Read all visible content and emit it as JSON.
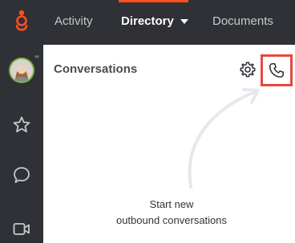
{
  "nav": {
    "tabs": [
      {
        "label": "Activity"
      },
      {
        "label": "Directory"
      },
      {
        "label": "Documents"
      }
    ],
    "active_tab": "Directory"
  },
  "rail": {
    "items": [
      "logo-icon",
      "avatar",
      "star-icon",
      "chat-bubble-icon",
      "video-icon"
    ]
  },
  "panel": {
    "title": "Conversations",
    "hint_line1": "Start new",
    "hint_line2": "outbound conversations"
  },
  "colors": {
    "nav_bg": "#2f3136",
    "accent": "#ff4f1f",
    "highlight_box": "#e8473c",
    "presence": "#7ab648"
  }
}
